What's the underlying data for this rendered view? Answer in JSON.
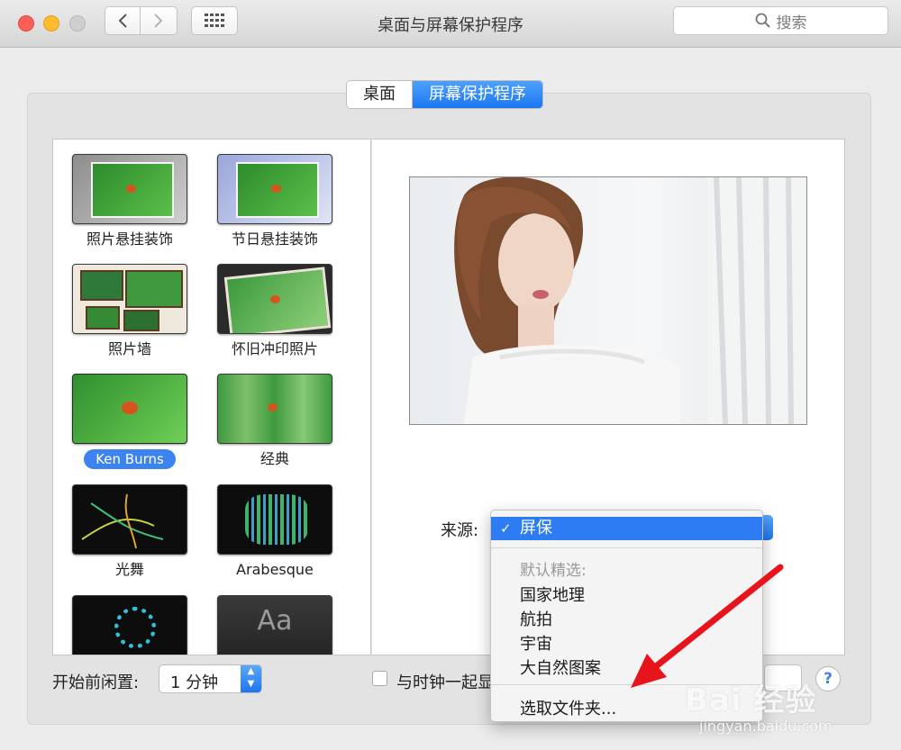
{
  "window": {
    "title": "桌面与屏幕保护程序"
  },
  "search": {
    "placeholder": "搜索"
  },
  "tabs": [
    {
      "label": "桌面",
      "selected": false
    },
    {
      "label": "屏幕保护程序",
      "selected": true
    }
  ],
  "screensavers": [
    {
      "label": "照片悬挂装饰",
      "selected": false
    },
    {
      "label": "节日悬挂装饰",
      "selected": false
    },
    {
      "label": "照片墙",
      "selected": false
    },
    {
      "label": "怀旧冲印照片",
      "selected": false
    },
    {
      "label": "Ken Burns",
      "selected": true
    },
    {
      "label": "经典",
      "selected": false
    },
    {
      "label": "光舞",
      "selected": false
    },
    {
      "label": "Arabesque",
      "selected": false
    },
    {
      "label": "",
      "selected": false
    },
    {
      "label": "",
      "selected": false,
      "thumb_text": "Aa"
    }
  ],
  "source": {
    "label": "来源:",
    "selected": "屏保",
    "menu_header": "默认精选:",
    "menu_items": [
      "国家地理",
      "航拍",
      "宇宙",
      "大自然图案"
    ],
    "folder_item": "选取文件夹..."
  },
  "idle": {
    "label": "开始前闲置:",
    "value": "1 分钟"
  },
  "clock": {
    "label": "与时钟一起显示",
    "checked": false
  },
  "help_label": "?",
  "watermark": {
    "main": "Bai 经验",
    "sub": "jingyan.baidu.com"
  },
  "colors": {
    "accent": "#2d7cf3",
    "arrow": "#e8141b"
  }
}
